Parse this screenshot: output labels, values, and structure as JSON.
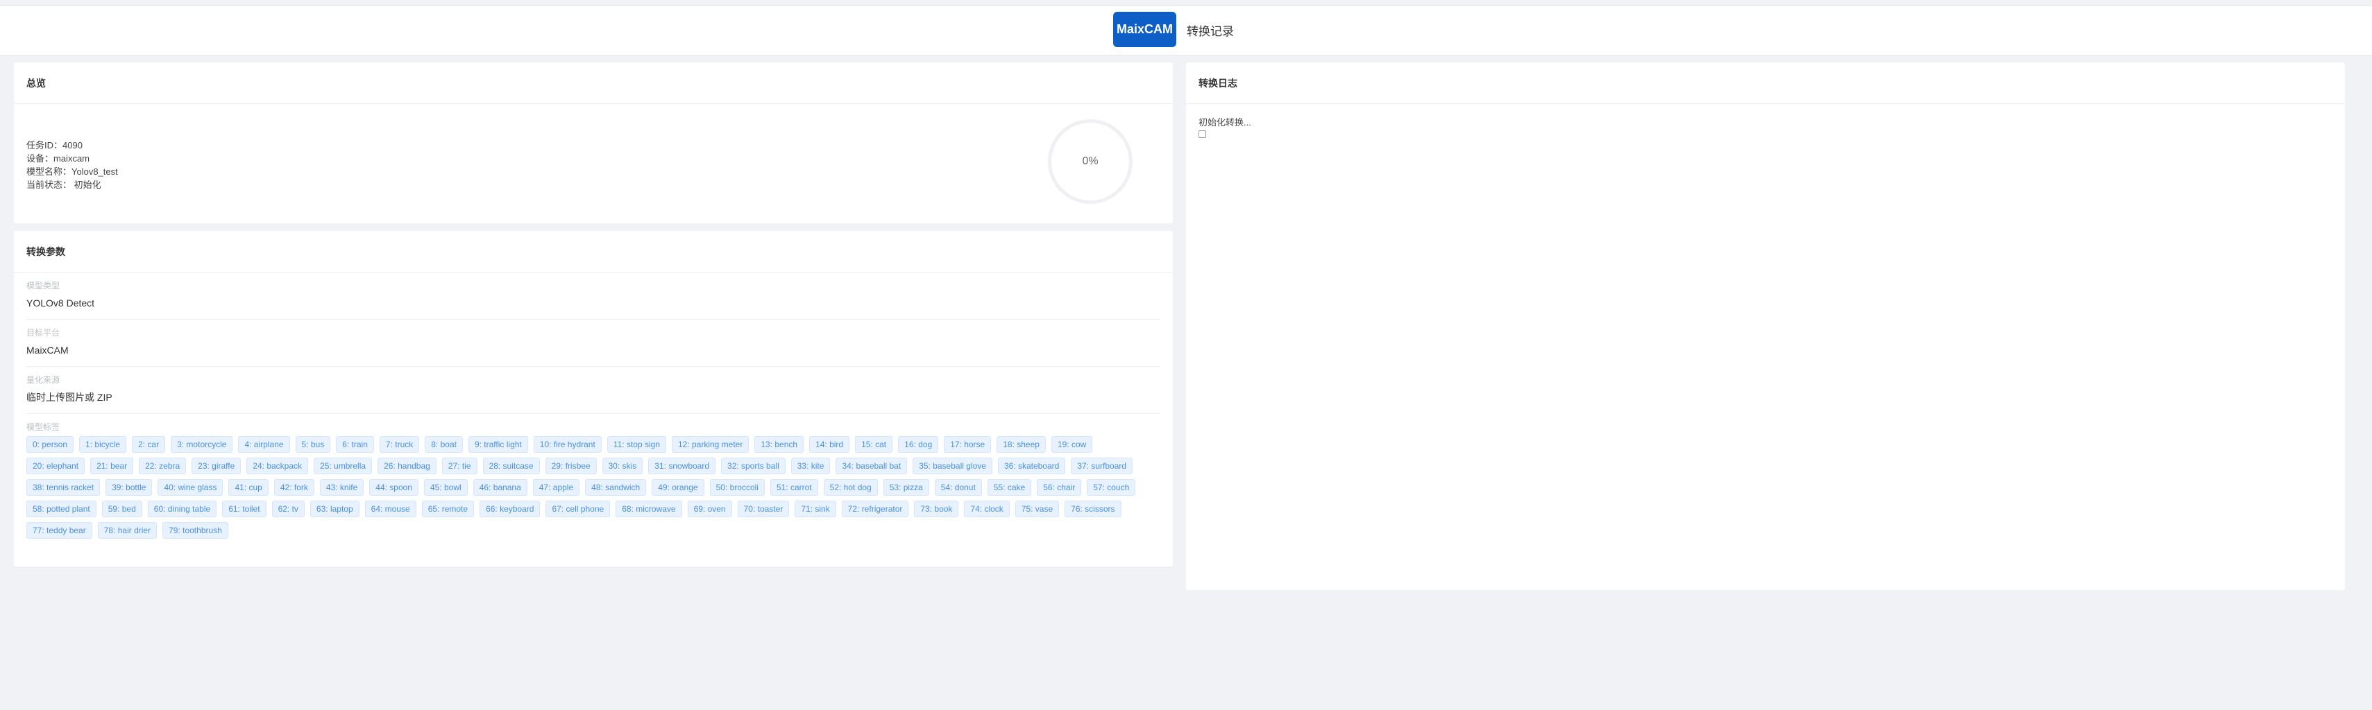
{
  "header": {
    "logo_text": "MaixCAM",
    "title": "转换记录"
  },
  "summary": {
    "title": "总览",
    "lines": [
      "任务ID：4090",
      "设备：maixcam",
      "模型名称：Yolov8_test",
      "当前状态： 初始化"
    ],
    "progress_text": "0%",
    "progress_value": 0
  },
  "params": {
    "title": "转换参数",
    "items": [
      {
        "label": "模型类型",
        "value": "YOLOv8 Detect"
      },
      {
        "label": "目标平台",
        "value": "MaixCAM"
      },
      {
        "label": "量化来源",
        "value": "临时上传图片或 ZIP"
      }
    ],
    "labels_title": "模型标签",
    "labels": [
      "0: person",
      "1: bicycle",
      "2: car",
      "3: motorcycle",
      "4: airplane",
      "5: bus",
      "6: train",
      "7: truck",
      "8: boat",
      "9: traffic light",
      "10: fire hydrant",
      "11: stop sign",
      "12: parking meter",
      "13: bench",
      "14: bird",
      "15: cat",
      "16: dog",
      "17: horse",
      "18: sheep",
      "19: cow",
      "20: elephant",
      "21: bear",
      "22: zebra",
      "23: giraffe",
      "24: backpack",
      "25: umbrella",
      "26: handbag",
      "27: tie",
      "28: suitcase",
      "29: frisbee",
      "30: skis",
      "31: snowboard",
      "32: sports ball",
      "33: kite",
      "34: baseball bat",
      "35: baseball glove",
      "36: skateboard",
      "37: surfboard",
      "38: tennis racket",
      "39: bottle",
      "40: wine glass",
      "41: cup",
      "42: fork",
      "43: knife",
      "44: spoon",
      "45: bowl",
      "46: banana",
      "47: apple",
      "48: sandwich",
      "49: orange",
      "50: broccoli",
      "51: carrot",
      "52: hot dog",
      "53: pizza",
      "54: donut",
      "55: cake",
      "56: chair",
      "57: couch",
      "58: potted plant",
      "59: bed",
      "60: dining table",
      "61: toilet",
      "62: tv",
      "63: laptop",
      "64: mouse",
      "65: remote",
      "66: keyboard",
      "67: cell phone",
      "68: microwave",
      "69: oven",
      "70: toaster",
      "71: sink",
      "72: refrigerator",
      "73: book",
      "74: clock",
      "75: vase",
      "76: scissors",
      "77: teddy bear",
      "78: hair drier",
      "79: toothbrush"
    ]
  },
  "log": {
    "title": "转换日志",
    "lines": [
      "初始化转换..."
    ]
  },
  "colors": {
    "brand": "#0d5fc7",
    "tag_bg": "#e8f2ff",
    "tag_text": "#4a90e2",
    "page_bg": "#f0f2f5"
  }
}
